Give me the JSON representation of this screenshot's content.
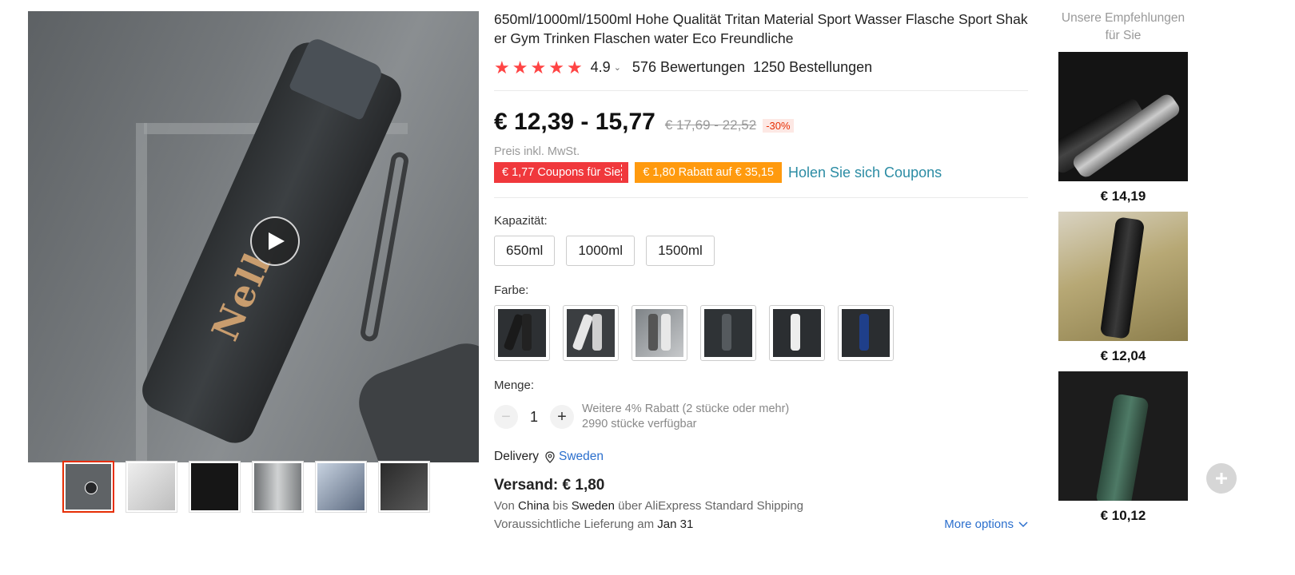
{
  "gallery": {
    "brand_text": "Nell",
    "thumbnails": [
      {
        "name": "thumb-1",
        "bg": "#5f6366"
      },
      {
        "name": "thumb-2",
        "bg": "#d9d9d9"
      },
      {
        "name": "thumb-3",
        "bg": "#1b1b1b"
      },
      {
        "name": "thumb-4",
        "bg": "#9b9ea0"
      },
      {
        "name": "thumb-5",
        "bg": "#aab4c2"
      },
      {
        "name": "thumb-6",
        "bg": "#3a3a3a"
      }
    ]
  },
  "product": {
    "title": "650ml/1000ml/1500ml Hohe Qualität Tritan Material Sport Wasser Flasche Sport Shaker Gym Trinken Flaschen water Eco Freundliche",
    "rating": "4.9",
    "reviews": "576 Bewertungen",
    "orders": "1250 Bestellungen",
    "price": "€ 12,39 - 15,77",
    "old_price": "€ 17,69 - 22,52",
    "discount": "-30%",
    "tax_note": "Preis inkl. MwSt.",
    "coupon_red": "€ 1,77 Coupons für Sie",
    "coupon_orange": "€ 1,80 Rabatt auf € 35,15",
    "coupon_link": "Holen Sie sich Coupons",
    "capacity_label": "Kapazität:",
    "capacities": [
      "650ml",
      "1000ml",
      "1500ml"
    ],
    "color_label": "Farbe:",
    "quantity_label": "Menge:",
    "quantity": "1",
    "qty_discount": "Weitere 4% Rabatt (2 stücke oder mehr)",
    "stock": "2990 stücke verfügbar",
    "delivery_label": "Delivery",
    "delivery_country": "Sweden",
    "shipping_price": "Versand: € 1,80",
    "shipping_from_pre": "Von ",
    "shipping_from": "China",
    "shipping_mid": " bis ",
    "shipping_to": "Sweden",
    "shipping_via": " über AliExpress Standard Shipping",
    "eta_pre": "Voraussichtliche Lieferung am ",
    "eta_date": "Jan 31",
    "more_options": "More options"
  },
  "colors": {
    "star": "#ff4747",
    "coupon_red": "#f0383c",
    "coupon_orange": "#ff9a0e",
    "link": "#2b6fcd",
    "active_border": "#e62e04"
  },
  "recommendations": {
    "title": "Unsere Empfehlungen für Sie",
    "items": [
      {
        "price": "€ 14,19"
      },
      {
        "price": "€ 12,04"
      },
      {
        "price": "€ 10,12"
      }
    ]
  }
}
